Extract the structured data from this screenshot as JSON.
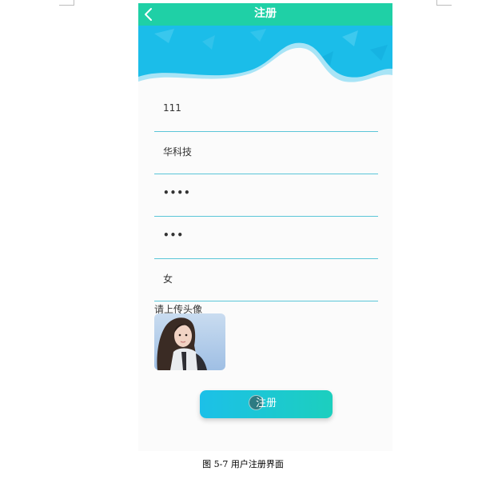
{
  "header": {
    "title": "注册",
    "back_icon": "chevron-left-icon"
  },
  "form": {
    "fields": [
      {
        "value": "111"
      },
      {
        "value": "华科技"
      },
      {
        "value": "••••"
      },
      {
        "value": "•••"
      },
      {
        "value": "女"
      }
    ],
    "avatar_label": "请上传头像",
    "submit_label": "注册"
  },
  "caption": "图 5-7  用户注册界面",
  "colors": {
    "header": "#1fd0a6",
    "banner": "#1bbde9",
    "underline": "#5bc6d8",
    "button_start": "#1cc0e8",
    "button_end": "#1ccfbe"
  }
}
